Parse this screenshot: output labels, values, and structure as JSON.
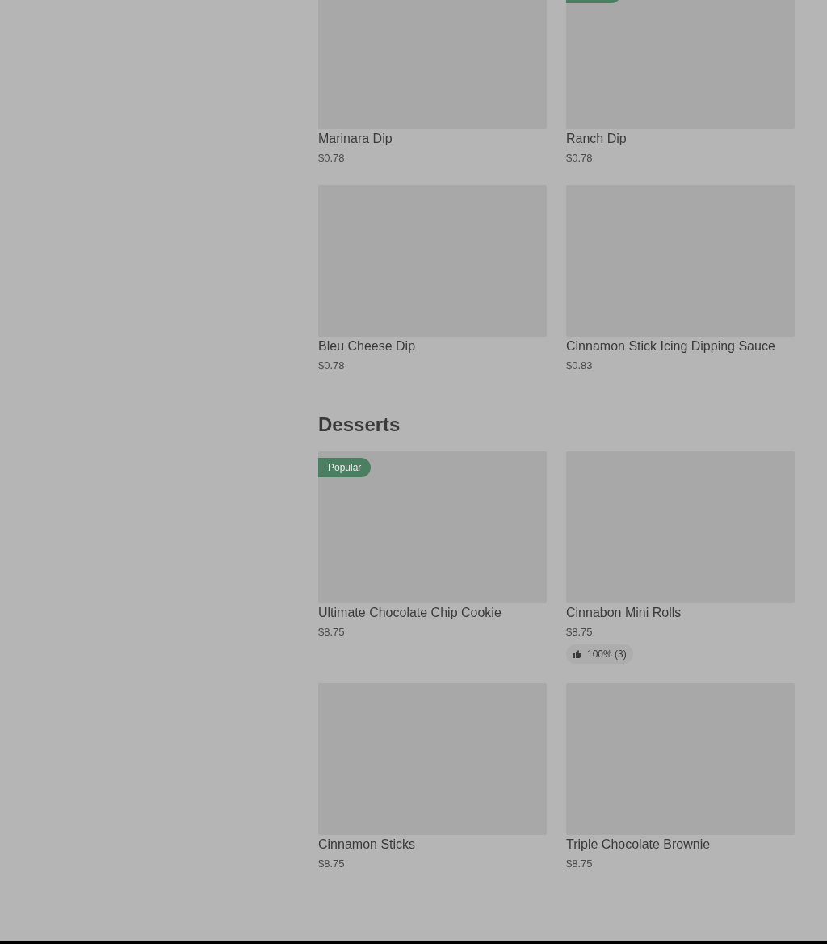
{
  "sections": [
    {
      "items": [
        {
          "name": "Marinara Dip",
          "price": "$0.78"
        },
        {
          "name": "Ranch Dip",
          "price": "$0.78",
          "badge_cut": true
        },
        {
          "name": "Bleu Cheese Dip",
          "price": "$0.78"
        },
        {
          "name": "Cinnamon Stick Icing Dipping Sauce",
          "price": "$0.83"
        }
      ]
    },
    {
      "title": "Desserts",
      "items": [
        {
          "name": "Ultimate Chocolate Chip Cookie",
          "price": "$8.75",
          "badge": "Popular"
        },
        {
          "name": "Cinnabon Mini Rolls",
          "price": "$8.75",
          "rating": "100% (3)"
        },
        {
          "name": "Cinnamon Sticks",
          "price": "$8.75"
        },
        {
          "name": "Triple Chocolate Brownie",
          "price": "$8.75"
        }
      ]
    }
  ]
}
